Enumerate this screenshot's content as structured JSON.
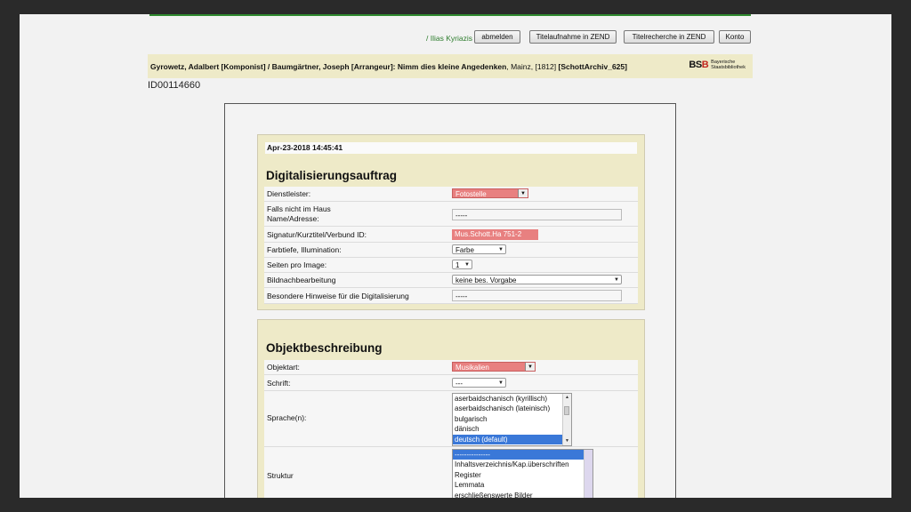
{
  "header": {
    "user": "/ Ilias Kyriazis",
    "buttons": [
      "abmelden",
      "Titelaufnahme in ZEND",
      "Titelrecherche in ZEND",
      "Konto"
    ]
  },
  "record": {
    "title_bold": "Gyrowetz, Adalbert [Komponist] / Baumgärtner, Joseph [Arrangeur]: Nimm dies kleine Angedenken",
    "title_place": ", Mainz, [1812]",
    "title_suffix": " [SchottArchiv_625]",
    "logo": {
      "mark_b": "BS",
      "mark_red": "B",
      "line1": "Bayerische",
      "line2": "Staatsbibliothek"
    },
    "id": "ID00114660"
  },
  "auftrag": {
    "timestamp": "Apr-23-2018 14:45:41",
    "heading": "Digitalisierungsauftrag",
    "dienstleister_label": "Dienstleister:",
    "dienstleister_value": "Fotostelle",
    "falls_label_1": "Falls nicht im Haus",
    "falls_label_2": "Name/Adresse:",
    "falls_value": "-----",
    "signatur_label": "Signatur/Kurztitel/Verbund ID:",
    "signatur_value": "Mus.Schott.Ha 751-2",
    "farbtiefe_label": "Farbtiefe, Illumination:",
    "farbtiefe_value": "Farbe",
    "seiten_label": "Seiten pro Image:",
    "seiten_value": "1",
    "bild_label": "Bildnachbearbeitung",
    "bild_value": "keine bes. Vorgabe",
    "hinweise_label": "Besondere Hinweise für die Digitalisierung",
    "hinweise_value": "-----"
  },
  "objekt": {
    "heading": "Objektbeschreibung",
    "objektart_label": "Objektart:",
    "objektart_value": "Musikalien",
    "schrift_label": "Schrift:",
    "schrift_value": "---",
    "sprache_label": "Sprache(n):",
    "sprache_options": [
      "aserbaidschanisch (kyrillisch)",
      "aserbaidschanisch (lateinisch)",
      "bulgarisch",
      "dänisch",
      "deutsch (default)"
    ],
    "struktur_label": "Struktur",
    "struktur_options": [
      "---------------",
      "Inhaltsverzeichnis/Kap.überschriften",
      "Register",
      "Lemmata",
      "erschließenswerte Bilder"
    ]
  },
  "colors": {
    "accent_green": "#2f8a2f",
    "panel": "#eeeac8",
    "required_red": "#e88080",
    "selection_blue": "#3a78d8"
  }
}
